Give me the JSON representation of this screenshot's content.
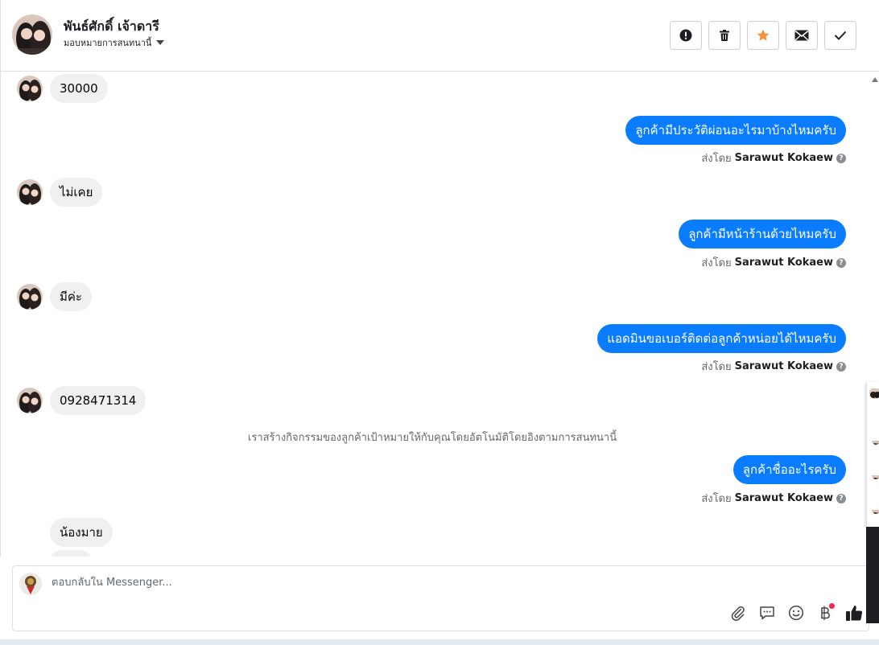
{
  "header": {
    "contact_name": "พันธ์ศักดิ์ เจ้าดารี",
    "assign_label": "มอบหมายการสนทนานี้",
    "actions": [
      {
        "name": "spam-button",
        "icon": "exclamation-circle-icon"
      },
      {
        "name": "delete-button",
        "icon": "trash-icon"
      },
      {
        "name": "star-button",
        "icon": "star-icon",
        "color": "#f7923b"
      },
      {
        "name": "mark-unread-button",
        "icon": "envelope-icon"
      },
      {
        "name": "mark-done-button",
        "icon": "checkmark-icon"
      }
    ]
  },
  "thread": {
    "messages": [
      {
        "dir": "in",
        "text": "30000"
      },
      {
        "dir": "out",
        "text": "ลูกค้ามีประวัติผ่อนอะไรมาบ้างไหมครับ"
      },
      {
        "dir": "in",
        "text": "ไม่เคย"
      },
      {
        "dir": "out",
        "text": "ลูกค้ามีหน้าร้านด้วยไหมครับ"
      },
      {
        "dir": "in",
        "text": "มีค่ะ"
      },
      {
        "dir": "out",
        "text": "แอดมินขอเบอร์ติดต่อลูกค้าหน่อยได้ไหมครับ"
      },
      {
        "dir": "in",
        "text": "0928471314"
      },
      {
        "dir": "out",
        "text": "ลูกค้าชื่ออะไรครับ"
      },
      {
        "dir": "in",
        "text": "น้องมาย"
      }
    ],
    "sent_by_prefix": "ส่งโดย",
    "sent_by_name": "Sarawut Kokaew",
    "system_notice": "เราสร้างกิจกรรมของลูกค้าเป้าหมายให้กับคุณโดยอัตโนมัติโดยอิงตามการสนทนานี้"
  },
  "composer": {
    "placeholder": "ตอบกลับใน Messenger...",
    "tools": [
      "paperclip-icon",
      "saved-replies-icon",
      "emoji-icon",
      "baht-payment-icon",
      "thumbs-up-icon"
    ]
  },
  "colors": {
    "outgoing_bubble": "#0a7cff",
    "incoming_bubble": "#f0f0f0",
    "star": "#f7923b"
  }
}
